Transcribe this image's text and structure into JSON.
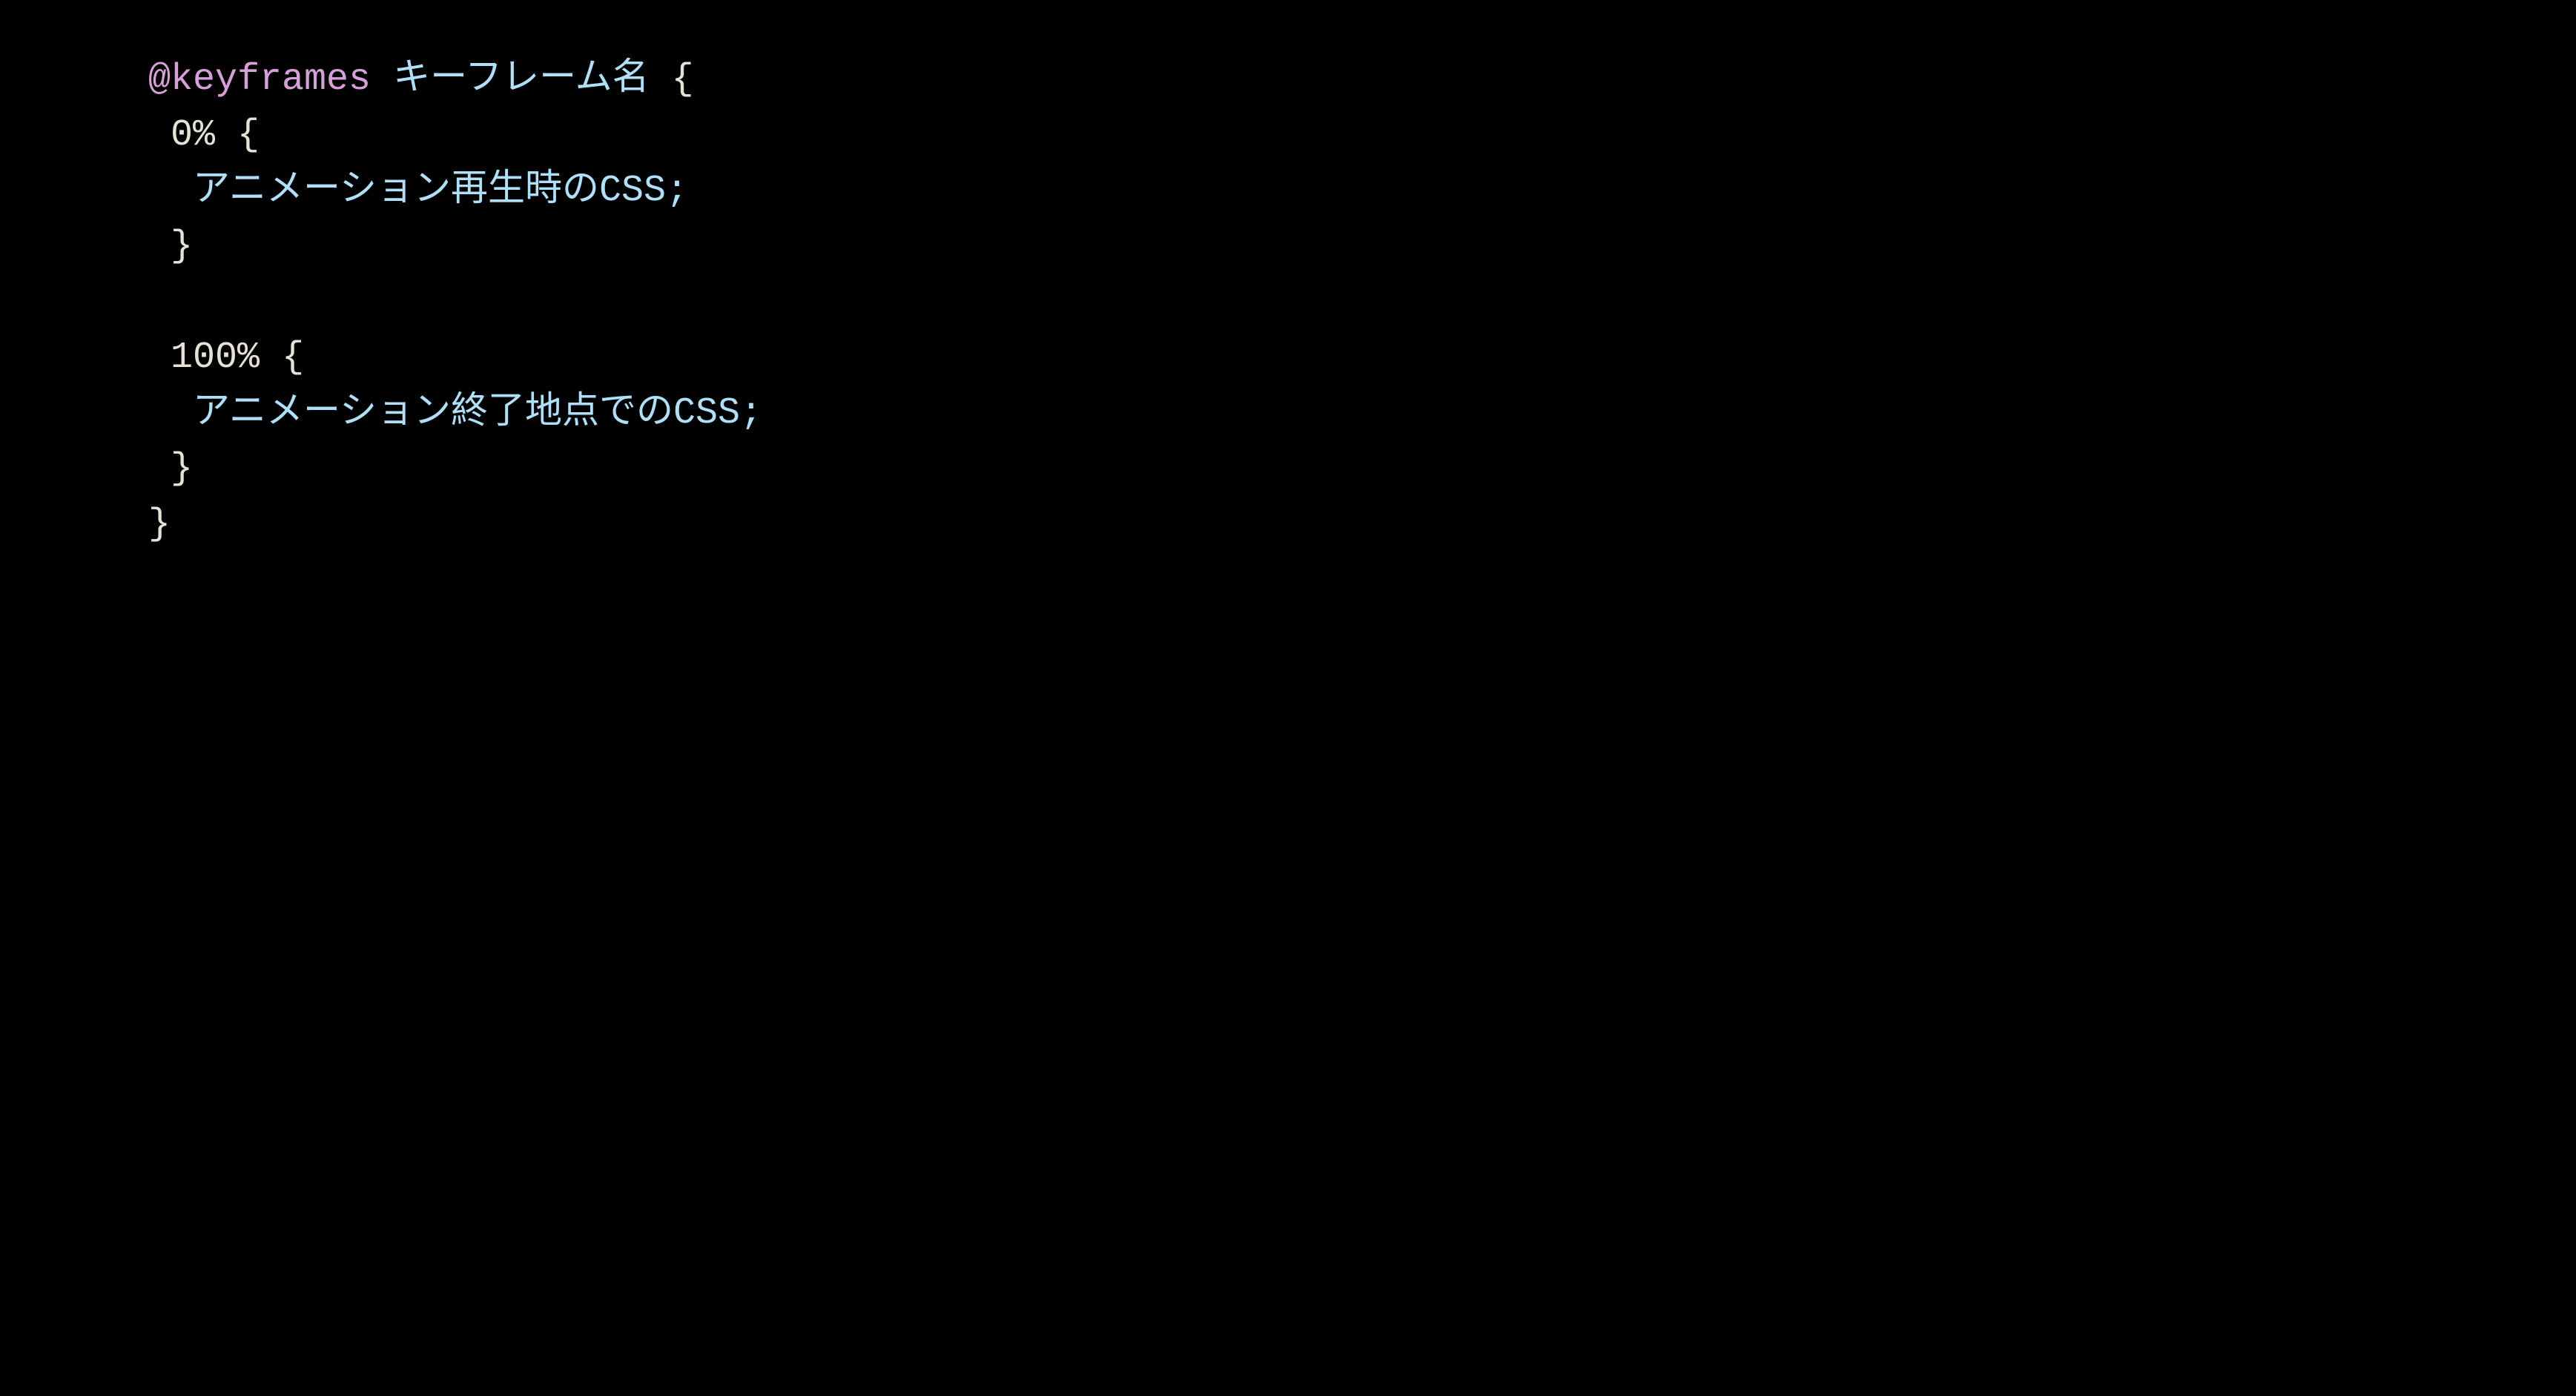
{
  "code": {
    "atrule": "@keyframes",
    "name": "キーフレーム名",
    "open": "{",
    "close": "}",
    "frames": [
      {
        "percent": "0%",
        "open": "{",
        "body": "アニメーション再生時のCSS;",
        "close": "}"
      },
      {
        "percent": "100%",
        "open": "{",
        "body": "アニメーション終了地点でのCSS;",
        "close": "}"
      }
    ]
  }
}
